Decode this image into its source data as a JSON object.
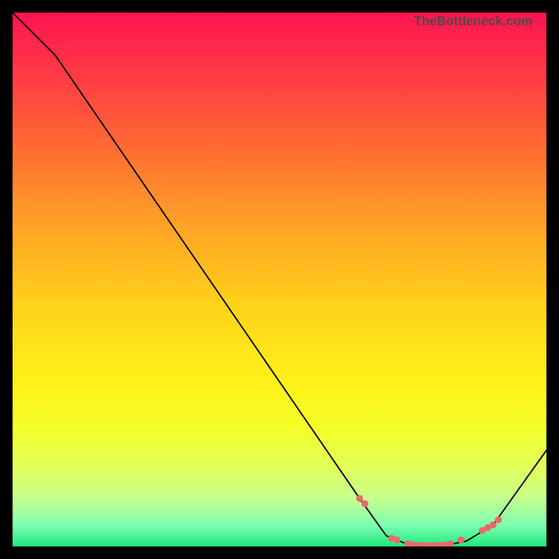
{
  "attribution": "TheBottleneck.com",
  "chart_data": {
    "type": "line",
    "title": "",
    "xlabel": "",
    "ylabel": "",
    "xlim": [
      0,
      100
    ],
    "ylim": [
      0,
      100
    ],
    "series": [
      {
        "name": "curve",
        "x": [
          0,
          8,
          65,
          70,
          75,
          80,
          85,
          90,
          100
        ],
        "y": [
          100,
          92,
          9,
          2,
          0,
          0,
          1,
          4,
          18
        ]
      }
    ],
    "markers": {
      "name": "highlight-dots",
      "x": [
        65,
        66,
        71,
        72,
        74,
        75,
        76,
        77,
        78,
        79,
        80,
        81,
        82,
        84,
        88,
        89,
        90,
        91
      ],
      "y": [
        9,
        8,
        1.5,
        1.2,
        0.5,
        0.3,
        0.2,
        0.2,
        0.2,
        0.2,
        0.2,
        0.3,
        0.5,
        1.2,
        3.0,
        3.5,
        4.0,
        5.0
      ]
    },
    "gradient_stops": [
      {
        "pos": 0.0,
        "color": "#ff1450"
      },
      {
        "pos": 0.25,
        "color": "#ff6a33"
      },
      {
        "pos": 0.55,
        "color": "#ffd31a"
      },
      {
        "pos": 0.78,
        "color": "#f4ff2a"
      },
      {
        "pos": 1.0,
        "color": "#20e97b"
      }
    ]
  }
}
